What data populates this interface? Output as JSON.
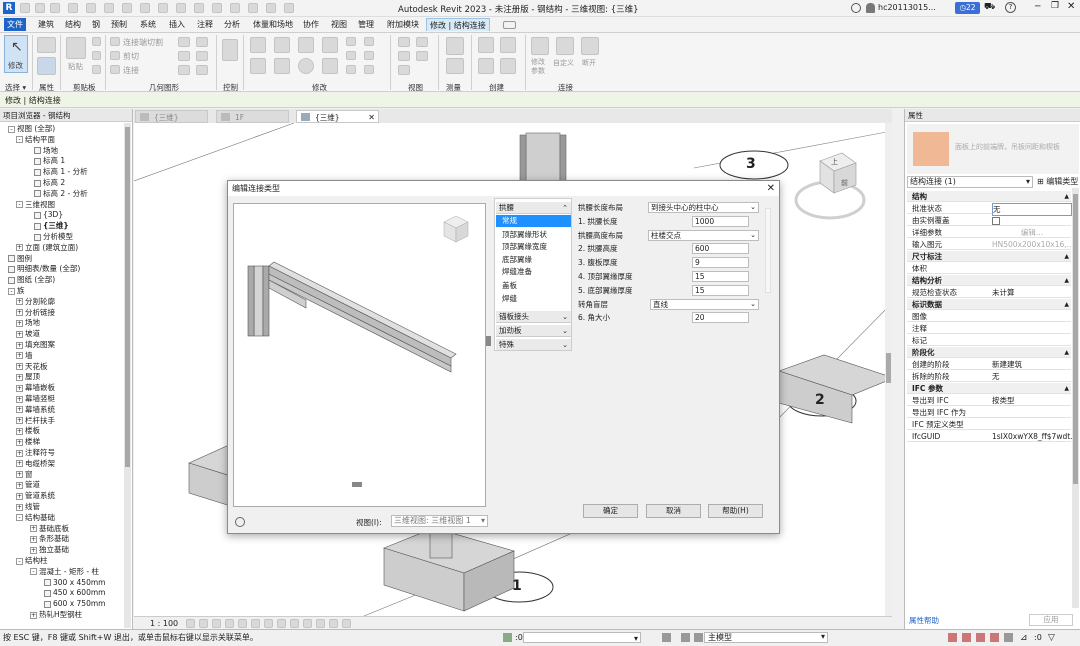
{
  "app": {
    "title": "Autodesk Revit 2023 - 未注册版 - 钢结构 - 三维视图: {三维}",
    "user": "hc20113015...",
    "badge": "22"
  },
  "ribbon_tabs": [
    {
      "label": "文件"
    },
    {
      "label": "建筑"
    },
    {
      "label": "结构"
    },
    {
      "label": "钢"
    },
    {
      "label": "预制"
    },
    {
      "label": "系统"
    },
    {
      "label": "插入"
    },
    {
      "label": "注释"
    },
    {
      "label": "分析"
    },
    {
      "label": "体量和场地"
    },
    {
      "label": "协作"
    },
    {
      "label": "视图"
    },
    {
      "label": "管理"
    },
    {
      "label": "附加模块"
    },
    {
      "label": "修改 | 结构连接"
    }
  ],
  "ribbon": {
    "modify_label": "修改",
    "paste_label": "粘贴",
    "clip_items": [
      "连接端切割",
      "剪切",
      "连接"
    ],
    "group_labels": [
      "选择",
      "属性",
      "剪贴板",
      "几何图形",
      "控制",
      "修改",
      "视图",
      "测量",
      "创建",
      "连接"
    ],
    "conn_buttons": [
      "修改参数",
      "自定义",
      "断开"
    ]
  },
  "option_bar": {
    "context": "修改 | 结构连接"
  },
  "browser": {
    "title": "项目浏览器 - 钢结构",
    "items": [
      {
        "label": "视图 (全部)",
        "tog": "-"
      },
      {
        "label": "结构平面",
        "tog": "-"
      },
      {
        "label": "场地",
        "tog": ""
      },
      {
        "label": "标高 1",
        "tog": ""
      },
      {
        "label": "标高 1 - 分析",
        "tog": ""
      },
      {
        "label": "标高 2",
        "tog": ""
      },
      {
        "label": "标高 2 - 分析",
        "tog": ""
      },
      {
        "label": "三维视图",
        "tog": "-"
      },
      {
        "label": "{3D}",
        "tog": ""
      },
      {
        "label": "{三维}",
        "tog": ""
      },
      {
        "label": "分析模型",
        "tog": ""
      },
      {
        "label": "立面 (建筑立面)",
        "tog": "+"
      },
      {
        "label": "图例",
        "tog": ""
      },
      {
        "label": "明细表/数量 (全部)",
        "tog": ""
      },
      {
        "label": "图纸 (全部)",
        "tog": ""
      },
      {
        "label": "族",
        "tog": "-"
      },
      {
        "label": "分割轮廓",
        "tog": "+"
      },
      {
        "label": "分析链接",
        "tog": "+"
      },
      {
        "label": "场地",
        "tog": "+"
      },
      {
        "label": "坡道",
        "tog": "+"
      },
      {
        "label": "填充图案",
        "tog": "+"
      },
      {
        "label": "墙",
        "tog": "+"
      },
      {
        "label": "天花板",
        "tog": "+"
      },
      {
        "label": "屋顶",
        "tog": "+"
      },
      {
        "label": "幕墙嵌板",
        "tog": "+"
      },
      {
        "label": "幕墙竖梃",
        "tog": "+"
      },
      {
        "label": "幕墙系统",
        "tog": "+"
      },
      {
        "label": "栏杆扶手",
        "tog": "+"
      },
      {
        "label": "楼板",
        "tog": "+"
      },
      {
        "label": "楼梯",
        "tog": "+"
      },
      {
        "label": "注释符号",
        "tog": "+"
      },
      {
        "label": "电缆桥架",
        "tog": "+"
      },
      {
        "label": "窗",
        "tog": "+"
      },
      {
        "label": "管道",
        "tog": "+"
      },
      {
        "label": "管道系统",
        "tog": "+"
      },
      {
        "label": "线管",
        "tog": "+"
      },
      {
        "label": "结构基础",
        "tog": "-"
      },
      {
        "label": "基础底板",
        "tog": "+"
      },
      {
        "label": "条形基础",
        "tog": "+"
      },
      {
        "label": "独立基础",
        "tog": "+"
      },
      {
        "label": "结构柱",
        "tog": "-"
      },
      {
        "label": "混凝土 - 矩形 - 柱",
        "tog": "-"
      },
      {
        "label": "300 x 450mm",
        "tog": ""
      },
      {
        "label": "450 x 600mm",
        "tog": ""
      },
      {
        "label": "600 x 750mm",
        "tog": ""
      },
      {
        "label": "热轧H型钢柱",
        "tog": "+"
      }
    ]
  },
  "view_tabs": [
    {
      "label": "{三维}"
    },
    {
      "label": "1F"
    },
    {
      "label": "{三维}"
    }
  ],
  "canvas": {
    "grid_labels": [
      "3",
      "2",
      "1"
    ],
    "cube_top": "上",
    "cube_front": "前"
  },
  "view_status": {
    "scale": "1 : 100"
  },
  "properties": {
    "title": "属性",
    "preview_hint": "面板上的前端牌，吊板间距和楔板",
    "type_selector": "结构连接 (1)",
    "edit_type": "编辑类型",
    "rows": [
      {
        "k": "结构",
        "v": "",
        "sec": true
      },
      {
        "k": "批准状态",
        "v": "无"
      },
      {
        "k": "由实例覆盖",
        "v": ""
      },
      {
        "k": "详细参数",
        "v": "编辑..."
      },
      {
        "k": "输入图元",
        "v": "HN500x200x10x16,..."
      },
      {
        "k": "尺寸标注",
        "v": "",
        "sec": true
      },
      {
        "k": "体积",
        "v": ""
      },
      {
        "k": "结构分析",
        "v": "",
        "sec": true
      },
      {
        "k": "规范检查状态",
        "v": "未计算"
      },
      {
        "k": "标识数据",
        "v": "",
        "sec": true
      },
      {
        "k": "图像",
        "v": ""
      },
      {
        "k": "注释",
        "v": ""
      },
      {
        "k": "标记",
        "v": ""
      },
      {
        "k": "阶段化",
        "v": "",
        "sec": true
      },
      {
        "k": "创建的阶段",
        "v": "新建建筑"
      },
      {
        "k": "拆除的阶段",
        "v": "无"
      },
      {
        "k": "IFC 参数",
        "v": "",
        "sec": true
      },
      {
        "k": "导出到 IFC",
        "v": "按类型"
      },
      {
        "k": "导出到 IFC 作为",
        "v": ""
      },
      {
        "k": "IFC 预定义类型",
        "v": ""
      },
      {
        "k": "IfcGUID",
        "v": "1sIX0xwYX8_ff$7wdt..."
      }
    ],
    "help_link": "属性帮助",
    "apply": "应用"
  },
  "dialog": {
    "title": "编辑连接类型",
    "view_label": "视图(I):",
    "view_value": "三维视图: 三维视图 1",
    "tabs": [
      {
        "label": "拱腰",
        "hdr": true
      },
      {
        "label": "常规",
        "sel": true
      },
      {
        "label": "顶部翼缘形状"
      },
      {
        "label": "顶部翼缘宽度"
      },
      {
        "label": "底部翼缘"
      },
      {
        "label": "焊缝准备"
      },
      {
        "label": "盖板"
      },
      {
        "label": "焊缝"
      },
      {
        "label": "锚板接头",
        "hdr": true
      },
      {
        "label": "加劲板",
        "hdr": true
      },
      {
        "label": "特殊",
        "hdr": true
      }
    ],
    "params": [
      {
        "label": "拱腰长度布局",
        "value": "到接头中心的柱中心",
        "kind": "dd"
      },
      {
        "label": "1. 拱腰长度",
        "value": "1000",
        "kind": "in"
      },
      {
        "label": "拱腰高度布局",
        "value": "柱楼交点",
        "kind": "dd"
      },
      {
        "label": "2. 拱腰高度",
        "value": "600",
        "kind": "in"
      },
      {
        "label": "3. 腹板厚度",
        "value": "9",
        "kind": "in"
      },
      {
        "label": "4. 顶部翼缘厚度",
        "value": "15",
        "kind": "in"
      },
      {
        "label": "5. 底部翼缘厚度",
        "value": "15",
        "kind": "in"
      },
      {
        "label": "转角盲层",
        "value": "直线",
        "kind": "dd2"
      },
      {
        "label": "6. 角大小",
        "value": "20",
        "kind": "in"
      }
    ],
    "ok": "确定",
    "cancel": "取消",
    "help": "帮助(H)"
  },
  "status": {
    "hint": "按 ESC 键，F8 键或 Shift+W 退出，或单击鼠标右键以显示关联菜单。",
    "zero": ":0",
    "model": "主模型"
  }
}
